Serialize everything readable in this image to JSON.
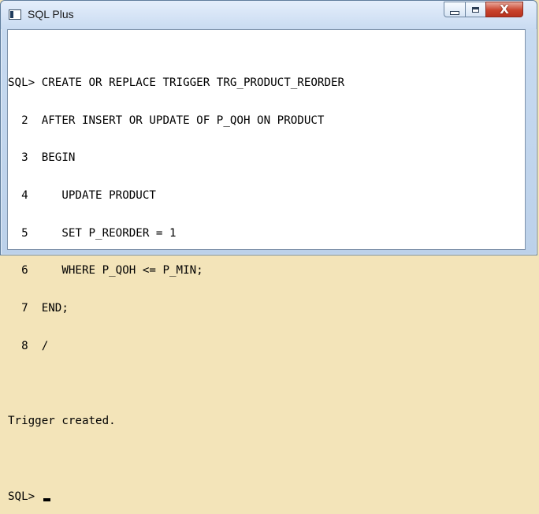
{
  "window": {
    "title": "SQL Plus",
    "icon": "sqlplus-window-icon"
  },
  "controls": {
    "minimize_icon": "minimize-icon",
    "maximize_icon": "maximize-icon",
    "close_glyph": "X"
  },
  "console": {
    "lines": [
      "SQL> CREATE OR REPLACE TRIGGER TRG_PRODUCT_REORDER",
      "  2  AFTER INSERT OR UPDATE OF P_QOH ON PRODUCT",
      "  3  BEGIN",
      "  4     UPDATE PRODUCT",
      "  5     SET P_REORDER = 1",
      "  6     WHERE P_QOH <= P_MIN;",
      "  7  END;",
      "  8  /",
      "",
      "Trigger created.",
      "",
      "SQL> "
    ]
  },
  "colors": {
    "desktop": "#f3e4b9",
    "close_button": "#c9442d",
    "console_background": "#ffffff",
    "console_text": "#000000"
  }
}
